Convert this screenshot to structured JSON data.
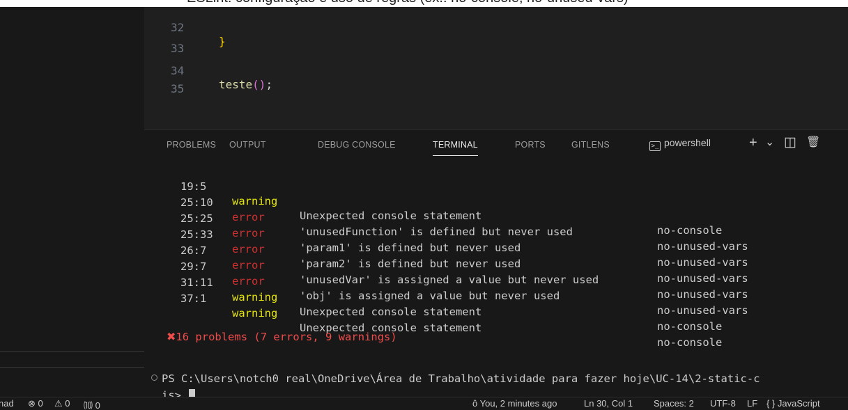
{
  "caption": "ESLint: configuração e uso de regras (ex.: no-console, no-unused-vars)",
  "editor": {
    "lines": [
      {
        "num": "32",
        "code": "}"
      },
      {
        "num": "33",
        "code": ""
      },
      {
        "num": "34",
        "fn": "teste",
        "paren": "()",
        "semi": ";"
      },
      {
        "num": "35",
        "code": ""
      }
    ]
  },
  "panel": {
    "tabs": [
      "PROBLEMS",
      "OUTPUT",
      "DEBUG CONSOLE",
      "TERMINAL",
      "PORTS",
      "GITLENS"
    ],
    "active_tab": "TERMINAL",
    "terminal_name": "powershell",
    "terminal_icon_glyph": ">_",
    "icons": {
      "add": "+",
      "dropdown": "⌄",
      "split": "◫",
      "trash": "🗑"
    }
  },
  "lint_results": [
    {
      "loc": "19:5",
      "severity": "warning",
      "message": "Unexpected console statement",
      "rule": "no-console"
    },
    {
      "loc": "25:10",
      "severity": "error",
      "message": "'unusedFunction' is defined but never used",
      "rule": "no-unused-vars"
    },
    {
      "loc": "25:25",
      "severity": "error",
      "message": "'param1' is defined but never used",
      "rule": "no-unused-vars"
    },
    {
      "loc": "25:33",
      "severity": "error",
      "message": "'param2' is defined but never used",
      "rule": "no-unused-vars"
    },
    {
      "loc": "26:7",
      "severity": "error",
      "message": "'unusedVar' is assigned a value but never used",
      "rule": "no-unused-vars"
    },
    {
      "loc": "29:7",
      "severity": "error",
      "message": "'obj' is assigned a value but never used",
      "rule": "no-unused-vars"
    },
    {
      "loc": "31:11",
      "severity": "warning",
      "message": "Unexpected console statement",
      "rule": "no-console"
    },
    {
      "loc": "37:1",
      "severity": "warning",
      "message": "Unexpected console statement",
      "rule": "no-console"
    }
  ],
  "summary": {
    "icon": "✖",
    "text": "16 problems (7 errors, 9 warnings)"
  },
  "prompt": {
    "line1": "PS C:\\Users\\notch0 real\\OneDrive\\Área de Trabalho\\atividade para fazer hoje\\UC-14\\2-static-c",
    "line2": "is>"
  },
  "status_bar": {
    "left_mode": "nad",
    "errors": "⊗ 0",
    "warnings": "⚠ 0",
    "ports": "⑽ 0",
    "blame": "You, 2 minutes ago",
    "position": "Ln 30, Col 1",
    "spaces": "Spaces: 2",
    "encoding": "UTF-8",
    "eol": "LF",
    "language": "{ } JavaScript"
  },
  "colors": {
    "warning": "#e5e510",
    "error": "#cd3131",
    "summary": "#f14c4c"
  }
}
